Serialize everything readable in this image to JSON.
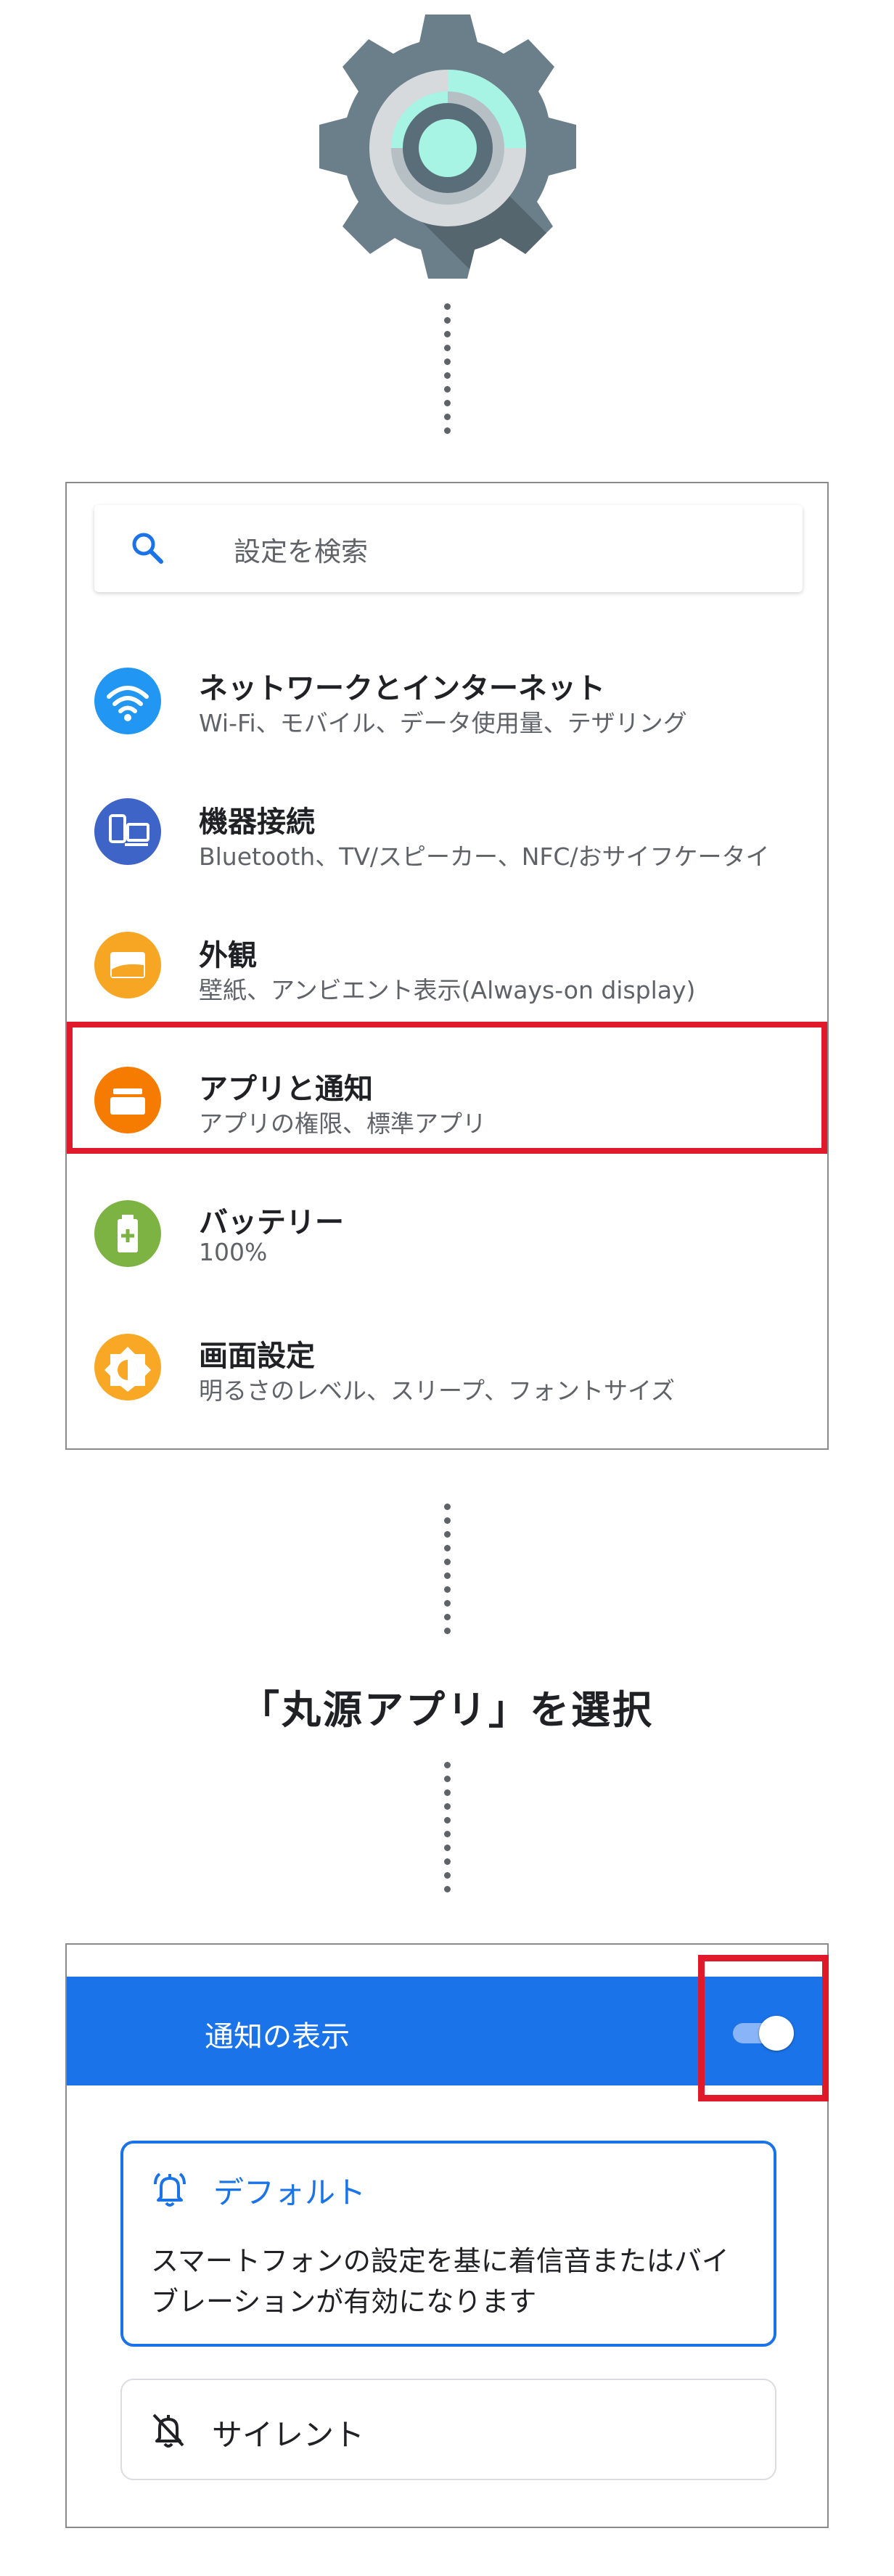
{
  "settings": {
    "search_placeholder": "設定を検索",
    "items": [
      {
        "title": "ネットワークとインターネット",
        "subtitle": "Wi-Fi、モバイル、データ使用量、テザリング",
        "icon": "wifi-icon",
        "color": "#2196f3"
      },
      {
        "title": "機器接続",
        "subtitle": "Bluetooth、TV/スピーカー、NFC/おサイフケータイ",
        "icon": "devices-icon",
        "color": "#3e64c8"
      },
      {
        "title": "外観",
        "subtitle": "壁紙、アンビエント表示(Always-on display)",
        "icon": "wallpaper-icon",
        "color": "#f6a623"
      },
      {
        "title": "アプリと通知",
        "subtitle": "アプリの権限、標準アプリ",
        "icon": "apps-icon",
        "color": "#f57c00"
      },
      {
        "title": "バッテリー",
        "subtitle": "100%",
        "icon": "battery-icon",
        "color": "#7cb342"
      },
      {
        "title": "画面設定",
        "subtitle": "明るさのレベル、スリープ、フォントサイズ",
        "icon": "brightness-icon",
        "color": "#f9a825"
      }
    ],
    "highlight_color": "#e0192b"
  },
  "caption": "「丸源アプリ」を選択",
  "notifications": {
    "bar_label": "通知の表示",
    "toggle_on": true,
    "accent": "#1a73e8",
    "default_title": "デフォルト",
    "default_desc": "スマートフォンの設定を基に着信音またはバイブレーションが有効になります",
    "silent_title": "サイレント"
  }
}
